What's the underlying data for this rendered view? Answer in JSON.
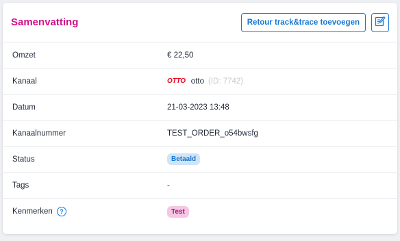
{
  "header": {
    "title": "Samenvatting",
    "track_button_label": "Retour track&trace toevoegen",
    "edit_icon": "edit-icon"
  },
  "rows": {
    "omzet": {
      "label": "Omzet",
      "value": "€ 22,50"
    },
    "kanaal": {
      "label": "Kanaal",
      "logo_text": "OTTO",
      "value": "otto",
      "id_text": "(ID: 7742)"
    },
    "datum": {
      "label": "Datum",
      "value": "21-03-2023 13:48"
    },
    "kanaalnummer": {
      "label": "Kanaalnummer",
      "value": "TEST_ORDER_o54bwsfg"
    },
    "status": {
      "label": "Status",
      "badge": "Betaald"
    },
    "tags": {
      "label": "Tags",
      "value": "-"
    },
    "kenmerken": {
      "label": "Kenmerken",
      "help_icon": "?",
      "badge": "Test"
    }
  },
  "colors": {
    "title": "#d1128a",
    "accent": "#1677d3",
    "badge_paid_bg": "#cfe4f8",
    "badge_test_bg": "#f6c6e4",
    "otto_red": "#e3051b"
  }
}
